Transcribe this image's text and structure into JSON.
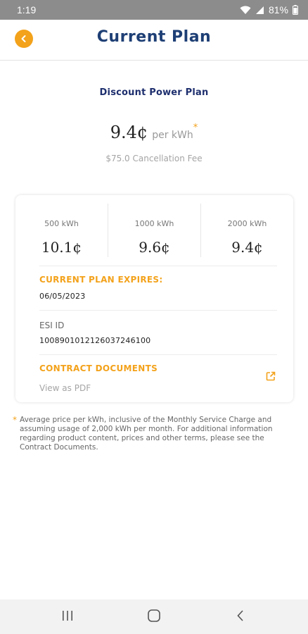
{
  "status_bar": {
    "time": "1:19",
    "battery": "81%"
  },
  "header": {
    "title": "Current Plan"
  },
  "plan": {
    "name": "Discount Power Plan",
    "price": "9.4¢",
    "unit": "per kWh",
    "asterisk": "*",
    "cancellation_fee": "$75.0 Cancellation Fee"
  },
  "tiers": [
    {
      "label": "500 kWh",
      "price": "10.1¢"
    },
    {
      "label": "1000 kWh",
      "price": "9.6¢"
    },
    {
      "label": "2000 kWh",
      "price": "9.4¢"
    }
  ],
  "expires": {
    "label": "CURRENT PLAN EXPIRES:",
    "value": "06/05/2023"
  },
  "esi": {
    "label": "ESI ID",
    "value": "10089010121260372461​00"
  },
  "documents": {
    "label": "CONTRACT DOCUMENTS",
    "link": "View as PDF"
  },
  "footnote": {
    "star": "*",
    "text": "Average price per kWh, inclusive of the Monthly Service Charge and assuming usage of 2,000 kWh per month. For additional information regarding product content, prices and other terms, please see the Contract Documents."
  },
  "colors": {
    "accent": "#f3a21b",
    "title": "#1e3f75",
    "plan_name": "#1e2f6e"
  },
  "icons": [
    "back-arrow-icon",
    "external-link-icon",
    "wifi-icon",
    "signal-icon",
    "battery-icon"
  ]
}
